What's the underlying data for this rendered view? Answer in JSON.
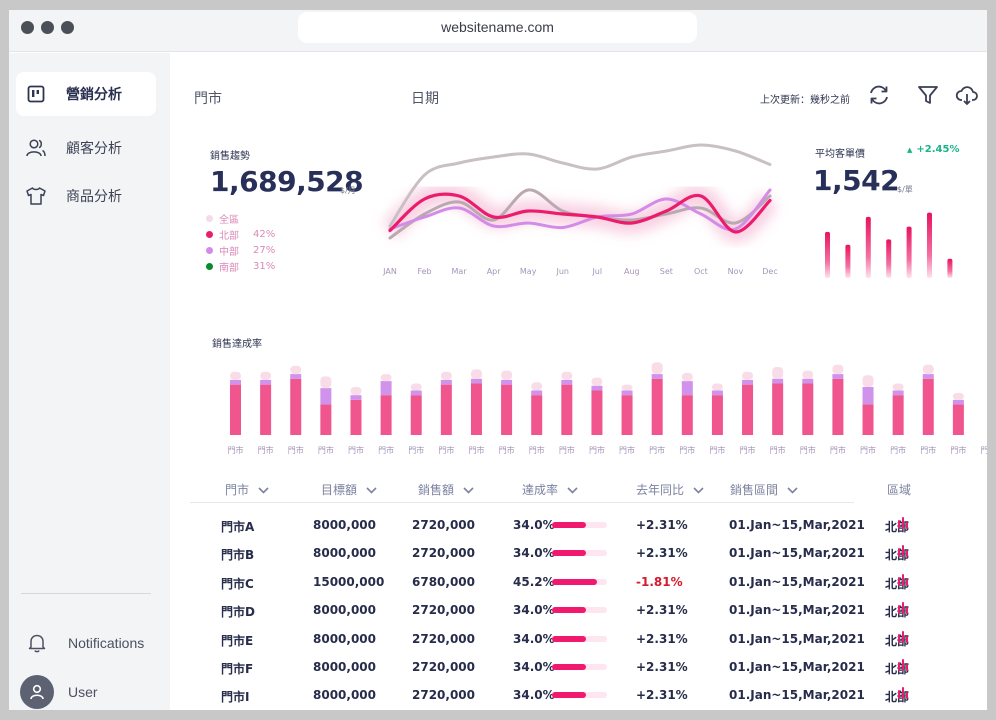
{
  "browser": {
    "url": "websitename.com"
  },
  "sidebar": {
    "items": [
      {
        "label": "營銷分析",
        "icon": "dashboard-icon",
        "active": true
      },
      {
        "label": "顧客分析",
        "icon": "users-icon",
        "active": false
      },
      {
        "label": "商品分析",
        "icon": "tshirt-icon",
        "active": false
      }
    ],
    "notifications_label": "Notifications",
    "user_label": "User"
  },
  "header": {
    "filter_store": "門市",
    "filter_date": "日期",
    "last_update": "上次更新：幾秒之前",
    "icons": [
      "refresh-icon",
      "filter-icon",
      "download-icon"
    ]
  },
  "sales_trend": {
    "label": "銷售趨勢",
    "value": "1,689,528",
    "unit": "$/月",
    "legend": [
      {
        "name": "全區",
        "pct": "",
        "color": "#f7d9ea"
      },
      {
        "name": "北部",
        "pct": "42%",
        "color": "#ec1c6c"
      },
      {
        "name": "中部",
        "pct": "27%",
        "color": "#d48be8"
      },
      {
        "name": "南部",
        "pct": "31%",
        "color": "#0a8a2f"
      }
    ]
  },
  "avg_price": {
    "label": "平均客單價",
    "change": "+2.45%",
    "value": "1,542",
    "unit": "$/單"
  },
  "achievement": {
    "label": "銷售達成率"
  },
  "table": {
    "headers": [
      "門市",
      "目標額",
      "銷售額",
      "達成率",
      "去年同比",
      "銷售區間",
      "區域"
    ],
    "rows": [
      {
        "store": "門市A",
        "target": "8000,000",
        "sales": "2720,000",
        "rate": "34.0%",
        "rate_value": 34.0,
        "yoy": "+2.31%",
        "negative": false,
        "period": "01.Jan~15,Mar,2021",
        "region": "北部"
      },
      {
        "store": "門市B",
        "target": "8000,000",
        "sales": "2720,000",
        "rate": "34.0%",
        "rate_value": 34.0,
        "yoy": "+2.31%",
        "negative": false,
        "period": "01.Jan~15,Mar,2021",
        "region": "北部"
      },
      {
        "store": "門市C",
        "target": "15000,000",
        "sales": "6780,000",
        "rate": "45.2%",
        "rate_value": 45.2,
        "yoy": "-1.81%",
        "negative": true,
        "period": "01.Jan~15,Mar,2021",
        "region": "北部"
      },
      {
        "store": "門市D",
        "target": "8000,000",
        "sales": "2720,000",
        "rate": "34.0%",
        "rate_value": 34.0,
        "yoy": "+2.31%",
        "negative": false,
        "period": "01.Jan~15,Mar,2021",
        "region": "北部"
      },
      {
        "store": "門市E",
        "target": "8000,000",
        "sales": "2720,000",
        "rate": "34.0%",
        "rate_value": 34.0,
        "yoy": "+2.31%",
        "negative": false,
        "period": "01.Jan~15,Mar,2021",
        "region": "北部"
      },
      {
        "store": "門市F",
        "target": "8000,000",
        "sales": "2720,000",
        "rate": "34.0%",
        "rate_value": 34.0,
        "yoy": "+2.31%",
        "negative": false,
        "period": "01.Jan~15,Mar,2021",
        "region": "北部"
      },
      {
        "store": "門市I",
        "target": "8000,000",
        "sales": "2720,000",
        "rate": "34.0%",
        "rate_value": 34.0,
        "yoy": "+2.31%",
        "negative": false,
        "period": "01.Jan~15,Mar,2021",
        "region": "北部"
      }
    ]
  },
  "chart_data": [
    {
      "type": "line",
      "categories": [
        "JAN",
        "Feb",
        "Mar",
        "Apr",
        "May",
        "Jun",
        "Jul",
        "Aug",
        "Set",
        "Oct",
        "Nov",
        "Dec"
      ],
      "series": [
        {
          "name": "全區",
          "color": "#c8c0c4",
          "values": [
            38,
            72,
            80,
            84,
            86,
            80,
            76,
            84,
            88,
            92,
            88,
            79
          ]
        },
        {
          "name": "北部",
          "color": "#ec1c6c",
          "values": [
            35,
            56,
            58,
            44,
            48,
            46,
            44,
            40,
            48,
            58,
            34,
            55
          ]
        },
        {
          "name": "中部",
          "color": "#d48be8",
          "values": [
            36,
            44,
            50,
            38,
            40,
            37,
            44,
            46,
            56,
            46,
            36,
            62
          ]
        },
        {
          "name": "南部",
          "color": "#b9aab0",
          "values": [
            30,
            46,
            54,
            42,
            62,
            48,
            44,
            42,
            46,
            50,
            40,
            58
          ]
        }
      ],
      "ylim": [
        0,
        100
      ],
      "xlabel": "",
      "ylabel": "",
      "title": "",
      "grid": false
    },
    {
      "type": "bar",
      "categories": [
        "",
        "",
        "",
        "",
        "",
        "",
        ""
      ],
      "values": [
        43,
        31,
        57,
        36,
        48,
        61,
        18
      ],
      "ylim": [
        0,
        70
      ],
      "xlabel": "",
      "ylabel": "",
      "title": ""
    },
    {
      "type": "bar",
      "stacked": true,
      "categories": [
        "門市",
        "門市",
        "門市",
        "門市",
        "門市",
        "門市",
        "門市",
        "門市",
        "門市",
        "門市",
        "門市",
        "門市",
        "門市",
        "門市",
        "門市",
        "門市",
        "門市",
        "門市",
        "門市",
        "門市",
        "門市",
        "門市",
        "門市",
        "門市",
        "門市",
        "門市"
      ],
      "series": [
        {
          "name": "",
          "color": "#f1558e",
          "values": [
            43,
            43,
            48,
            26,
            30,
            34,
            34,
            43,
            44,
            43,
            34,
            43,
            38,
            34,
            48,
            34,
            34,
            43,
            44,
            44,
            48,
            26,
            34,
            48,
            26,
            48
          ]
        },
        {
          "name": "",
          "color": "#d092ea",
          "values": [
            4,
            4,
            4,
            14,
            4,
            12,
            4,
            4,
            4,
            4,
            4,
            4,
            4,
            4,
            4,
            12,
            4,
            4,
            4,
            4,
            4,
            15,
            4,
            4,
            4,
            4
          ]
        },
        {
          "name": "",
          "color": "#f8dde9",
          "values": [
            7,
            7,
            7,
            10,
            7,
            6,
            6,
            7,
            8,
            8,
            7,
            7,
            7,
            5,
            10,
            7,
            6,
            7,
            10,
            7,
            8,
            10,
            6,
            8,
            6,
            8
          ]
        }
      ],
      "ylim": [
        0,
        70
      ],
      "xlabel": "",
      "ylabel": "",
      "title": ""
    }
  ]
}
